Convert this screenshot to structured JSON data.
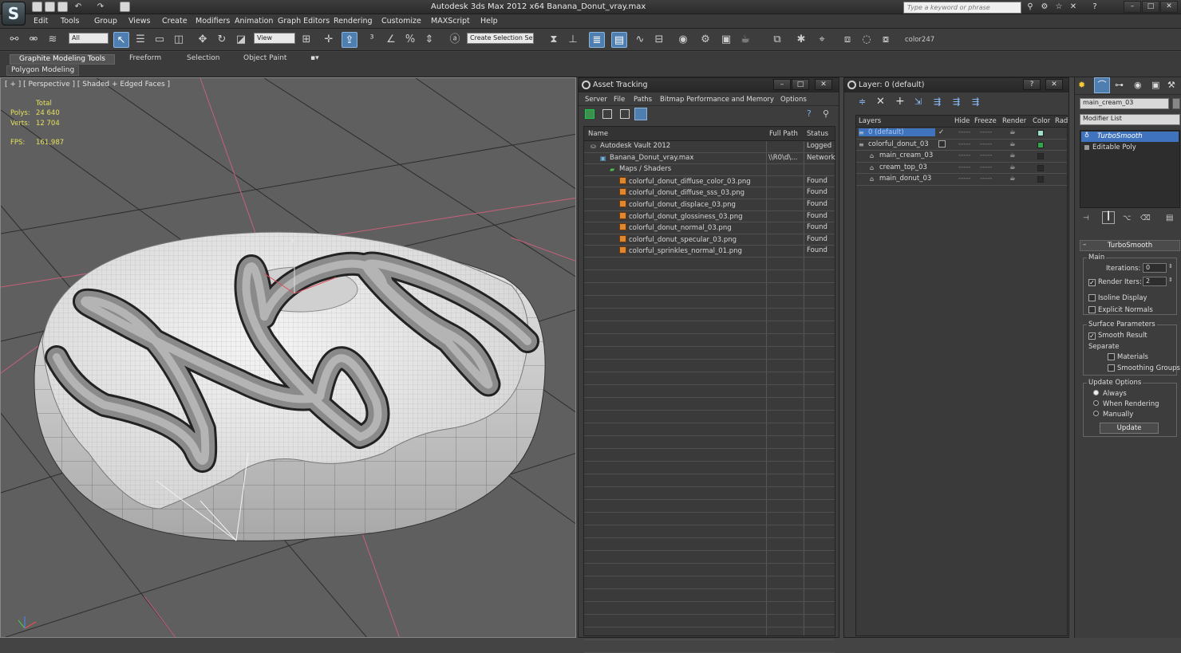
{
  "app": {
    "title": "Autodesk 3ds Max  2012 x64      Banana_Donut_vray.max",
    "search_placeholder": "Type a keyword or phrase",
    "logo_letter": "S"
  },
  "menu": [
    "Edit",
    "Tools",
    "Group",
    "Views",
    "Create",
    "Modifiers",
    "Animation",
    "Graph Editors",
    "Rendering",
    "Customize",
    "MAXScript",
    "Help"
  ],
  "toolbar": {
    "selection_filter": "All",
    "ref_coord": "View",
    "named_selection": "Create Selection Se",
    "color_label": "color247"
  },
  "ribbon": {
    "tabs": [
      "Graphite Modeling Tools",
      "Freeform",
      "Selection",
      "Object Paint"
    ],
    "active_tab": 0,
    "sub_label": "Polygon Modeling"
  },
  "viewport": {
    "label": "[ + ] [ Perspective ] [ Shaded + Edged Faces ]",
    "stats_header": "Total",
    "polys_label": "Polys:",
    "polys_value": "24 640",
    "verts_label": "Verts:",
    "verts_value": "12 704",
    "fps_label": "FPS:",
    "fps_value": "161,987",
    "axis_z": "z"
  },
  "asset_tracking": {
    "title": "Asset Tracking",
    "menu": [
      "Server",
      "File",
      "Paths",
      "Bitmap Performance and Memory",
      "Options"
    ],
    "columns": {
      "name": "Name",
      "path": "Full Path",
      "status": "Status"
    },
    "rows": [
      {
        "name": "Autodesk Vault 2012",
        "path": "",
        "status": "Logged",
        "indent": 0,
        "icon": "vault-icon"
      },
      {
        "name": "Banana_Donut_vray.max",
        "path": "\\\\R0\\d\\...",
        "status": "Network",
        "indent": 1,
        "icon": "max-file-icon"
      },
      {
        "name": "Maps / Shaders",
        "path": "",
        "status": "",
        "indent": 2,
        "icon": "maps-icon"
      },
      {
        "name": "colorful_donut_diffuse_color_03.png",
        "path": "",
        "status": "Found",
        "indent": 3,
        "icon": "bitmap-icon"
      },
      {
        "name": "colorful_donut_diffuse_sss_03.png",
        "path": "",
        "status": "Found",
        "indent": 3,
        "icon": "bitmap-icon"
      },
      {
        "name": "colorful_donut_displace_03.png",
        "path": "",
        "status": "Found",
        "indent": 3,
        "icon": "bitmap-icon"
      },
      {
        "name": "colorful_donut_glossiness_03.png",
        "path": "",
        "status": "Found",
        "indent": 3,
        "icon": "bitmap-icon"
      },
      {
        "name": "colorful_donut_normal_03.png",
        "path": "",
        "status": "Found",
        "indent": 3,
        "icon": "bitmap-icon"
      },
      {
        "name": "colorful_donut_specular_03.png",
        "path": "",
        "status": "Found",
        "indent": 3,
        "icon": "bitmap-icon"
      },
      {
        "name": "colorful_sprinkles_normal_01.png",
        "path": "",
        "status": "Found",
        "indent": 3,
        "icon": "bitmap-icon"
      }
    ]
  },
  "layers": {
    "title": "Layer: 0 (default)",
    "columns": {
      "layers": "Layers",
      "hide": "Hide",
      "freeze": "Freeze",
      "render": "Render",
      "color": "Color",
      "rad": "Rad"
    },
    "rows": [
      {
        "name": "0 (default)",
        "indent": 0,
        "selected": true,
        "check": "✓",
        "color": "#9ee0c8"
      },
      {
        "name": "colorful_donut_03",
        "indent": 0,
        "selected": false,
        "check": "",
        "color": "#2ea84a"
      },
      {
        "name": "main_cream_03",
        "indent": 1,
        "selected": false,
        "check": "",
        "color": "#2a2a2a"
      },
      {
        "name": "cream_top_03",
        "indent": 1,
        "selected": false,
        "check": "",
        "color": "#2a2a2a"
      },
      {
        "name": "main_donut_03",
        "indent": 1,
        "selected": false,
        "check": "",
        "color": "#2a2a2a"
      }
    ],
    "dots": "-----"
  },
  "command_panel": {
    "object_name": "main_cream_03",
    "modifier_list": "Modifier List",
    "stack": [
      "TurboSmooth",
      "Editable Poly"
    ],
    "rollout_title": "TurboSmooth",
    "main_group": "Main",
    "iterations_label": "Iterations:",
    "iterations_value": "0",
    "render_iters_label": "Render Iters:",
    "render_iters_value": "2",
    "isoline": "Isoline Display",
    "explicit_normals": "Explicit Normals",
    "surface_group": "Surface Parameters",
    "smooth_result": "Smooth Result",
    "separate": "Separate",
    "materials": "Materials",
    "smoothing_groups": "Smoothing Groups",
    "update_group": "Update Options",
    "always": "Always",
    "when_rendering": "When Rendering",
    "manually": "Manually",
    "update_button": "Update"
  },
  "colors": {
    "accent": "#4f7fb0",
    "selection": "#3f73bd",
    "bitmap": "#e0862d",
    "stats": "#e6e05a"
  }
}
